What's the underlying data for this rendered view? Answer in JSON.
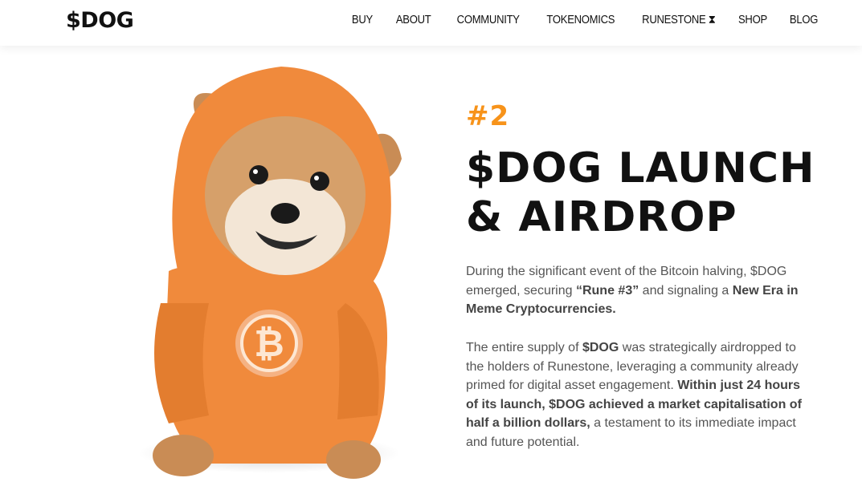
{
  "header": {
    "logo": "$DOG",
    "nav": [
      "BUY",
      "ABOUT",
      "COMMUNITY",
      "TOKENOMICS",
      "RUNESTONE ⧗",
      "SHOP",
      "BLOG"
    ]
  },
  "hero": {
    "number": "#2",
    "title_line1": "$DOG LAUNCH",
    "title_line2": "& AIRDROP",
    "para1": {
      "t1": "During the significant event of the Bitcoin halving, $DOG emerged, securing ",
      "b1": "“Rune #3”",
      "t2": " and signaling a ",
      "b2": "New Era in Meme Cryptocurrencies."
    },
    "para2": {
      "t1": "The entire supply of ",
      "b1": "$DOG",
      "t2": " was strategically airdropped to the holders of Runestone, leveraging a community already primed for digital asset engagement. ",
      "b2": "Within just 24 hours of its launch, $DOG achieved a market capitalisation of half a billion dollars,",
      "t3": " a testament to its immediate impact and future potential."
    },
    "accent_color": "#f7931a",
    "hoodie_color": "#f08a3c"
  }
}
